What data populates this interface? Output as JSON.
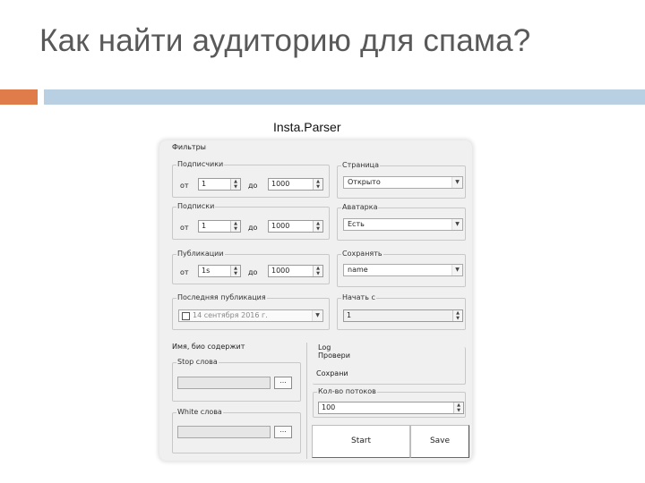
{
  "slide": {
    "title": "Как найти аудиторию для спама?",
    "caption": "Insta.Parser"
  },
  "window": {
    "filters_label": "Фильтры",
    "followers": {
      "label": "Подписчики",
      "from_label": "от",
      "from_value": "1",
      "to_label": "до",
      "to_value": "1000"
    },
    "following": {
      "label": "Подписки",
      "from_label": "от",
      "from_value": "1",
      "to_label": "до",
      "to_value": "1000"
    },
    "posts": {
      "label": "Публикации",
      "from_label": "от",
      "from_value": "1s",
      "to_label": "до",
      "to_value": "1000"
    },
    "last_post": {
      "label": "Последняя публикация",
      "date_value": "14 сентября 2016 г."
    },
    "page": {
      "label": "Страница",
      "value": "Открыто"
    },
    "avatar": {
      "label": "Аватарка",
      "value": "Есть"
    },
    "save_as": {
      "label": "Сохранять",
      "value": "name"
    },
    "start_from": {
      "label": "Начать с",
      "value": "1"
    },
    "bio": {
      "label": "Имя, био содержит",
      "stop_words_label": "Stop слова",
      "white_words_label": "White слова",
      "browse_label": "..."
    },
    "log": {
      "label": "Log",
      "checked_label": "Провери",
      "saved_label": "Сохрани"
    },
    "threads": {
      "label": "Кол-во потоков",
      "value": "100"
    },
    "buttons": {
      "start": "Start",
      "save": "Save"
    }
  }
}
